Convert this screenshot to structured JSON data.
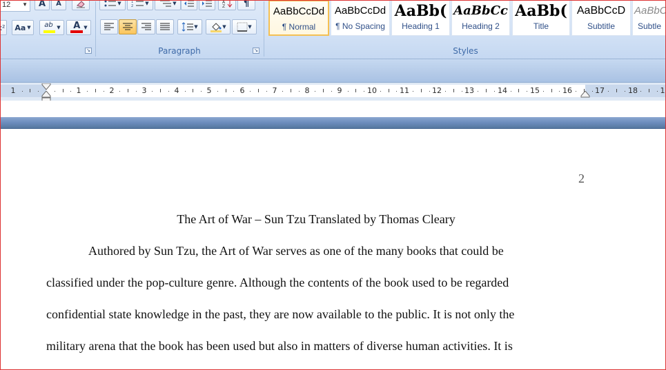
{
  "font_group": {
    "font_size_value": "12",
    "grow_font_label": "A",
    "shrink_font_label": "A",
    "change_case_label": "Aa",
    "highlight_label": "ab",
    "font_color_label": "A",
    "colors": {
      "highlight": "#ffff00",
      "font_color": "#e30000"
    }
  },
  "paragraph_group": {
    "label": "Paragraph"
  },
  "styles_group": {
    "label": "Styles",
    "tiles": [
      {
        "preview": "AaBbCcDd",
        "name": "¶ Normal"
      },
      {
        "preview": "AaBbCcDd",
        "name": "¶ No Spacing"
      },
      {
        "preview": "AaBb(",
        "name": "Heading 1"
      },
      {
        "preview": "AaBbCc",
        "name": "Heading 2"
      },
      {
        "preview": "AaBb(",
        "name": "Title"
      },
      {
        "preview": "AaBbCcD",
        "name": "Subtitle"
      },
      {
        "preview": "AaBbC",
        "name": "Subtle"
      }
    ]
  },
  "ruler": {
    "left_numbers": [
      "1"
    ],
    "numbers": [
      "1",
      "2",
      "3",
      "4",
      "5",
      "6",
      "7",
      "8",
      "9",
      "10",
      "11",
      "12",
      "13",
      "14",
      "15",
      "16",
      "17",
      "18",
      "1"
    ]
  },
  "document": {
    "page_number": "2",
    "title": "The Art of War – Sun Tzu Translated by Thomas Cleary",
    "lines": [
      "Authored by Sun Tzu, the Art of War serves as one of the many books that could be",
      "classified under the pop-culture genre. Although the contents of the book used to be regarded",
      "confidential state knowledge in the past, they are now available to the public. It is not only the",
      "military arena that the book has been used but also in matters of diverse human activities. It is"
    ]
  }
}
